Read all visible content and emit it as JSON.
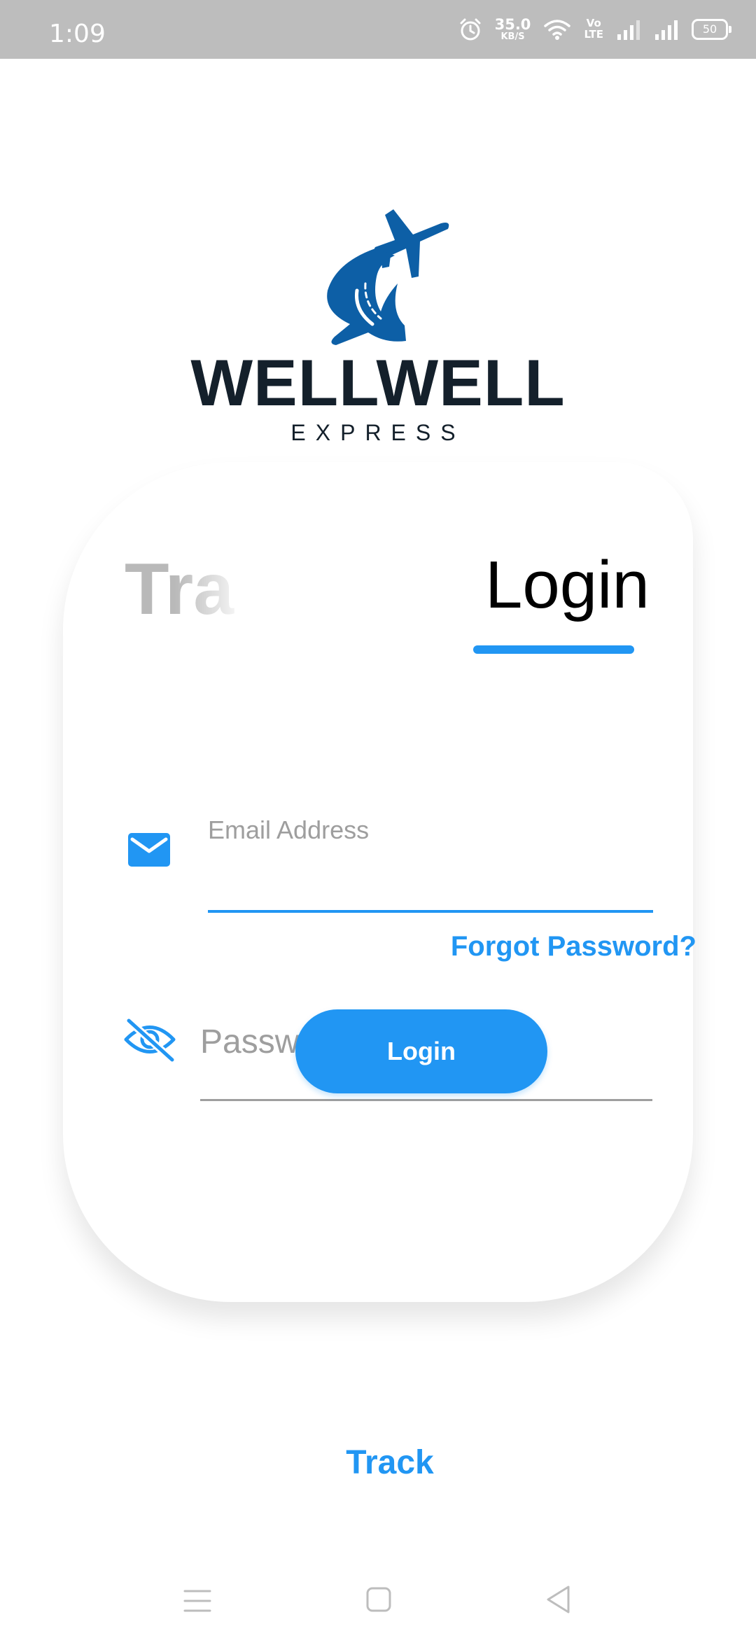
{
  "status_bar": {
    "time": "1:09",
    "net_speed_value": "35.0",
    "net_speed_unit": "KB/S",
    "volte_top": "Vo",
    "volte_bottom": "LTE",
    "battery_level": "50"
  },
  "brand": {
    "name": "WELLWELL",
    "tagline": "EXPRESS",
    "logo_icon": "airplane-swoosh-logo",
    "logo_color": "#0d5fa6",
    "text_color": "#14202b"
  },
  "tabs": {
    "track_label": "Track",
    "login_label": "Login",
    "active": "login"
  },
  "form": {
    "email_label": "Email Address",
    "email_value": "",
    "email_icon": "mail-icon",
    "forgot_password": "Forgot Password?",
    "password_placeholder": "Password",
    "password_value": "",
    "password_icon": "eye-off-icon",
    "login_button": "Login"
  },
  "footer": {
    "track_link": "Track"
  },
  "nav": {
    "menu_icon": "menu-icon",
    "home_icon": "home-square-icon",
    "back_icon": "back-triangle-icon"
  },
  "colors": {
    "accent": "#2196f3",
    "status_bar": "#bdbdbd",
    "inactive_tab": "#b9b9b9"
  }
}
